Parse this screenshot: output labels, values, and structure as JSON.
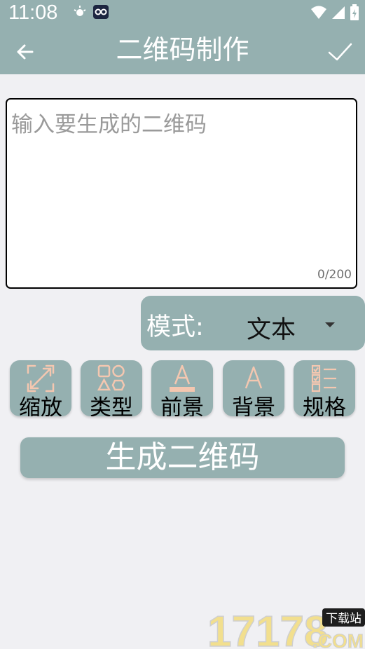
{
  "status": {
    "time": "11:08"
  },
  "appbar": {
    "title": "二维码制作"
  },
  "input": {
    "placeholder": "输入要生成的二维码",
    "counter": "0/200"
  },
  "mode": {
    "label": "模式:",
    "value": "文本"
  },
  "tools": [
    {
      "label": "缩放",
      "icon": "resize-icon"
    },
    {
      "label": "类型",
      "icon": "shapes-icon"
    },
    {
      "label": "前景",
      "icon": "text-color-icon"
    },
    {
      "label": "背景",
      "icon": "text-background-icon"
    },
    {
      "label": "规格",
      "icon": "checklist-icon"
    }
  ],
  "generate": {
    "label": "生成二维码"
  },
  "watermark": {
    "brand": "17178",
    "tag": "下载站",
    "suffix": ".COM"
  },
  "colors": {
    "accent": "#95b0b0",
    "background": "#f0f0f3",
    "icon_peach": "#f4c7b0"
  }
}
